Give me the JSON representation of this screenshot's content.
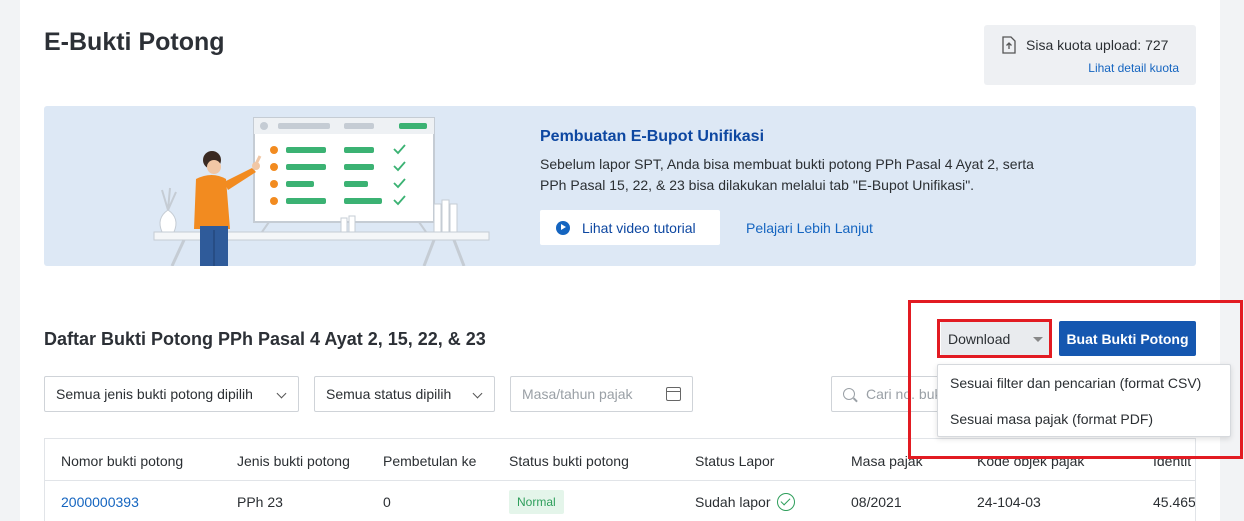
{
  "page": {
    "title": "E-Bukti Potong"
  },
  "quota": {
    "text": "Sisa kuota upload: 727",
    "link": "Lihat detail kuota",
    "icon": "upload-file-icon"
  },
  "banner": {
    "title": "Pembuatan E-Bupot Unifikasi",
    "description": "Sebelum lapor SPT, Anda bisa membuat bukti potong PPh Pasal 4 Ayat 2, serta PPh Pasal 15, 22, & 23 bisa dilakukan melalui tab \"E-Bupot Unifikasi\".",
    "video_button": "Lihat video tutorial",
    "learn_link": "Pelajari Lebih Lanjut",
    "illustration": "person-pointing-at-checklist-board"
  },
  "list": {
    "title": "Daftar Bukti Potong PPh Pasal 4 Ayat 2, 15, 22, & 23",
    "download_label": "Download",
    "create_label": "Buat Bukti Potong",
    "download_options": [
      "Sesuai filter dan pencarian (format CSV)",
      "Sesuai masa pajak (format PDF)"
    ]
  },
  "filters": {
    "type": "Semua jenis bukti potong dipilih",
    "status": "Semua status dipilih",
    "period_placeholder": "Masa/tahun pajak",
    "search_placeholder": "Cari no. bukti"
  },
  "table": {
    "headers": [
      "Nomor bukti potong",
      "Jenis bukti potong",
      "Pembetulan ke",
      "Status bukti potong",
      "Status Lapor",
      "Masa pajak",
      "Kode objek pajak",
      "Identit"
    ],
    "rows": [
      {
        "nomor": "2000000393",
        "jenis": "PPh 23",
        "pembetulan": "0",
        "status": "Normal",
        "lapor": "Sudah lapor",
        "masa": "08/2021",
        "kode": "24-104-03",
        "identitas": "45.465"
      }
    ]
  },
  "colors": {
    "primary": "#1557b0",
    "link": "#1565c0",
    "banner_bg": "#dde8f5",
    "highlight": "#e21b22",
    "success": "#2e9e5b"
  }
}
